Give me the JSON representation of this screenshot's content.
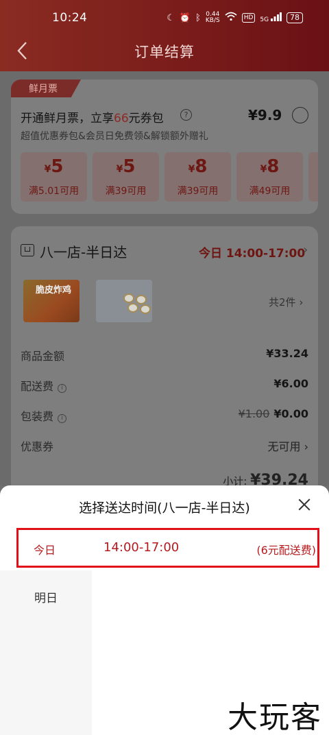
{
  "status_bar": {
    "time": "10:24",
    "net_speed": "0.44",
    "net_unit": "KB/S",
    "hd": "HD",
    "signal": "5G",
    "battery": "78"
  },
  "header": {
    "title": "订单结算"
  },
  "membership": {
    "tag": "鲜月票",
    "title_prefix": "开通鲜月票，立享",
    "title_highlight": "66",
    "title_suffix": "元券包",
    "help": "?",
    "price": "¥9.9",
    "subtitle": "超值优惠券包&会员日免费领&解锁额外赠礼",
    "coupons": [
      {
        "currency": "¥",
        "amount": "5",
        "condition": "满5.01可用"
      },
      {
        "currency": "¥",
        "amount": "5",
        "condition": "满39可用"
      },
      {
        "currency": "¥",
        "amount": "8",
        "condition": "满39可用"
      },
      {
        "currency": "¥",
        "amount": "8",
        "condition": "满49可用"
      }
    ]
  },
  "store": {
    "name": "八一店-半日达",
    "delivery_time": "今日 14:00-17:00",
    "product_label": "脆皮炸鸡",
    "item_count": "共2件",
    "rows": {
      "goods": {
        "label": "商品金额",
        "value": "¥33.24"
      },
      "delivery": {
        "label": "配送费",
        "value": "¥6.00"
      },
      "packaging": {
        "label": "包装费",
        "old_value": "¥1.00",
        "value": "¥0.00"
      },
      "coupon": {
        "label": "优惠券",
        "value": "无可用"
      }
    },
    "subtotal_label": "小计:",
    "subtotal_value": "¥39.24"
  },
  "sheet": {
    "title": "选择送达时间(八一店-半日达)",
    "today": {
      "day": "今日",
      "slot": "14:00-17:00",
      "fee": "(6元配送费)"
    },
    "tomorrow": {
      "day": "明日"
    }
  },
  "watermark": "大玩客",
  "colors": {
    "accent_red": "#e10f18",
    "price_red": "#b51a1f",
    "header_red": "#7a1c1a"
  }
}
